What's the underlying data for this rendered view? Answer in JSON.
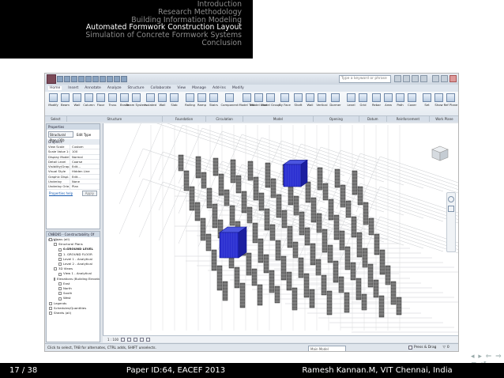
{
  "header": {
    "nav_items": [
      {
        "label": "Introduction",
        "active": false
      },
      {
        "label": "Research Methodology",
        "active": false
      },
      {
        "label": "Building Information Modeling",
        "active": false
      },
      {
        "label": "Automated Formwork Construction Layout",
        "active": true
      },
      {
        "label": "Simulation of Concrete Formwork Systems",
        "active": false
      },
      {
        "label": "Conclusion",
        "active": false
      }
    ]
  },
  "footer": {
    "page": "17 / 38",
    "center": "Paper ID:64, EACEF 2013",
    "right": "Ramesh Kannan.M, VIT Chennai, India"
  },
  "app": {
    "search_placeholder": "Type a keyword or phrase",
    "tabs": [
      "Home",
      "Insert",
      "Annotate",
      "Analyze",
      "Structure",
      "Collaborate",
      "View",
      "Manage",
      "Add-Ins",
      "Modify"
    ],
    "active_tab": "Home",
    "ribbon_buttons": [
      "Modify",
      "Beam",
      "Wall",
      "Column",
      "Floor",
      "Truss",
      "Brace",
      "Beam System",
      "Isolated",
      "Wall",
      "Slab",
      "Railing",
      "Ramp",
      "Stairs",
      "Component",
      "Model Text",
      "Model Line",
      "Model Group",
      "By Face",
      "Shaft",
      "Wall",
      "Vertical",
      "Dormer",
      "Level",
      "Grid",
      "Rebar",
      "Area",
      "Path",
      "Cover",
      "Set",
      "Show",
      "Ref Plane"
    ],
    "ribbon_panels": [
      "Select",
      "Structure",
      "Foundation",
      "Circulation",
      "Model",
      "Opening",
      "Datum",
      "Reinforcement",
      "Work Plane"
    ],
    "properties": {
      "title": "Properties",
      "type_selector": "Structural Plan (3D)",
      "edit_type": "Edit Type",
      "group": "Graphics",
      "rows": [
        {
          "key": "View Scale",
          "value": "Custom"
        },
        {
          "key": "Scale Value 1:",
          "value": "100"
        },
        {
          "key": "Display Model",
          "value": "Normal"
        },
        {
          "key": "Detail Level",
          "value": "Coarse"
        },
        {
          "key": "Visibility/Grap...",
          "value": "Edit..."
        },
        {
          "key": "Visual Style",
          "value": "Hidden Line"
        },
        {
          "key": "Graphic Displ...",
          "value": "Edit..."
        },
        {
          "key": "Underlay",
          "value": "None"
        },
        {
          "key": "Underlay Orie...",
          "value": "Plan"
        }
      ],
      "help_link": "Properties help",
      "apply": "Apply"
    },
    "browser": {
      "title": "CNBD65 - Constructability Of Conc...",
      "items": [
        {
          "label": "Views (all)",
          "level": 0,
          "bold": false
        },
        {
          "label": "Structural Plans",
          "level": 1,
          "bold": false
        },
        {
          "label": "0.GROUND LEVEL",
          "level": 2,
          "bold": true
        },
        {
          "label": "1. GROUND FLOOR",
          "level": 2,
          "bold": false
        },
        {
          "label": "Level 1 - Analytical",
          "level": 2,
          "bold": false
        },
        {
          "label": "Level 2 - Analytical",
          "level": 2,
          "bold": false
        },
        {
          "label": "3D Views",
          "level": 1,
          "bold": false
        },
        {
          "label": "View 1 - Analytical",
          "level": 2,
          "bold": false
        },
        {
          "label": "Elevations (Building Elevatio",
          "level": 1,
          "bold": false
        },
        {
          "label": "East",
          "level": 2,
          "bold": false
        },
        {
          "label": "North",
          "level": 2,
          "bold": false
        },
        {
          "label": "South",
          "level": 2,
          "bold": false
        },
        {
          "label": "West",
          "level": 2,
          "bold": false
        },
        {
          "label": "Legends",
          "level": 0,
          "bold": false
        },
        {
          "label": "Schedules/Quantities",
          "level": 0,
          "bold": false
        },
        {
          "label": "Sheets (all)",
          "level": 0,
          "bold": false
        }
      ]
    },
    "view_scale": "1 : 100",
    "status_text": "Click to select, TAB for alternates, CTRL adds, SHIFT unselects.",
    "model_selector": "Main Model",
    "press_drag": "Press & Drag",
    "filter_count": "0"
  },
  "colors": {
    "header_bg": "#000000",
    "nav_active": "#ffffff",
    "nav_inactive": "#8c8c8c",
    "formwork_blue": "#2a2ed0",
    "column_gray": "#6e6e6e"
  }
}
